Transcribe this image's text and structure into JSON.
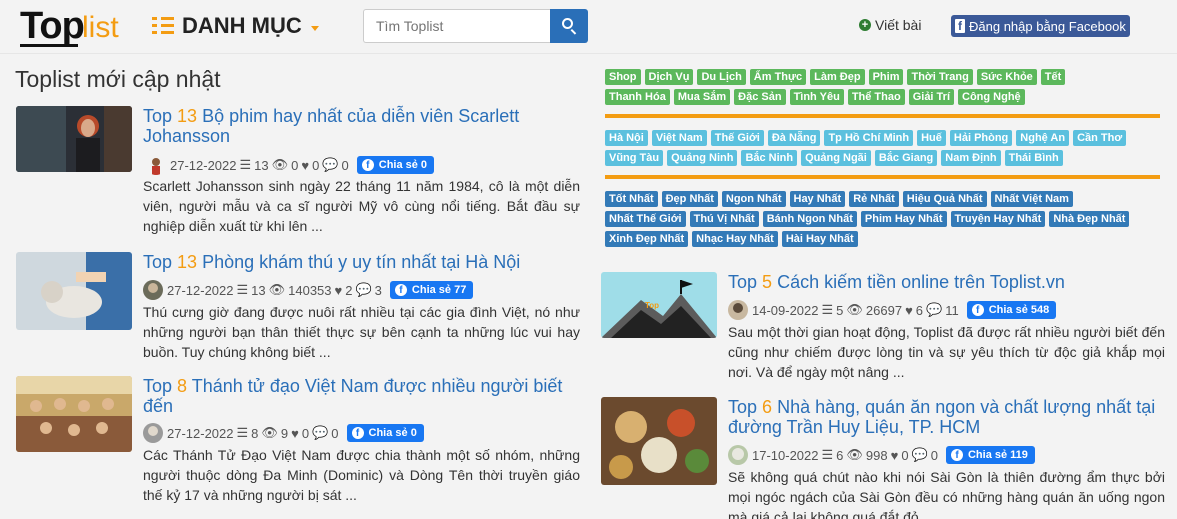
{
  "header": {
    "logo_text_1": "Top",
    "logo_text_2": "list",
    "menu_label": "DANH MỤC",
    "search_placeholder": "Tìm Toplist",
    "write_label": "Viết bài",
    "facebook_login_label": "Đăng nhập bằng Facebook"
  },
  "main": {
    "heading": "Toplist mới cập nhật"
  },
  "articles_left": [
    {
      "number": "13",
      "title_prefix": "Top",
      "title_rest": "Bộ phim hay nhất của diễn viên Scarlett Johansson",
      "date": "27-12-2022",
      "items": "13",
      "views": "0",
      "likes": "0",
      "comments": "0",
      "share_label": "Chia sẻ 0",
      "description": "Scarlett Johansson sinh ngày 22 tháng 11 năm 1984, cô là một diễn viên, người mẫu và ca sĩ người Mỹ vô cùng nổi tiếng. Bắt đầu sự nghiệp diễn xuất từ khi lên ..."
    },
    {
      "number": "13",
      "title_prefix": "Top",
      "title_rest": "Phòng khám thú y uy tín nhất tại Hà Nội",
      "date": "27-12-2022",
      "items": "13",
      "views": "140353",
      "likes": "2",
      "comments": "3",
      "share_label": "Chia sẻ 77",
      "description": "Thú cưng giờ đang được nuôi rất nhiều tại các gia đình Việt, nó như những người bạn thân thiết thực sự bên cạnh ta những lúc vui hay buồn. Tuy chúng không biết ..."
    },
    {
      "number": "8",
      "title_prefix": "Top",
      "title_rest": "Thánh tử đạo Việt Nam được nhiều người biết đến",
      "date": "27-12-2022",
      "items": "8",
      "views": "9",
      "likes": "0",
      "comments": "0",
      "share_label": "Chia sẻ 0",
      "description": "Các Thánh Tử Đạo Việt Nam được chia thành một số nhóm, những người thuộc dòng Đa Minh (Dominic) và Dòng Tên thời truyền giáo thế kỷ 17 và những người bị sát ..."
    }
  ],
  "articles_right": [
    {
      "number": "5",
      "title_prefix": "Top",
      "title_rest": "Cách kiếm tiền online trên Toplist.vn",
      "date": "14-09-2022",
      "items": "5",
      "views": "26697",
      "likes": "6",
      "comments": "11",
      "share_label": "Chia sẻ 548",
      "description": "Sau một thời gian hoạt động, Toplist đã được rất nhiều người biết đến cũng như chiếm được lòng tin và sự yêu thích từ độc giả khắp mọi nơi. Và để ngày một nâng ..."
    },
    {
      "number": "6",
      "title_prefix": "Top",
      "title_rest": "Nhà hàng, quán ăn ngon và chất lượng nhất tại đường Trần Huy Liệu, TP. HCM",
      "date": "17-10-2022",
      "items": "6",
      "views": "998",
      "likes": "0",
      "comments": "0",
      "share_label": "Chia sẻ 119",
      "description": "Sẽ không quá chút nào khi nói Sài Gòn là thiên đường ẩm thực bởi mọi ngóc ngách của Sài Gòn đều có những hàng quán ăn uống ngon mà giá cả lại không quá đắt đỏ ..."
    }
  ],
  "tags_categories": [
    "Shop",
    "Dịch Vụ",
    "Du Lịch",
    "Ẩm Thực",
    "Làm Đẹp",
    "Phim",
    "Thời Trang",
    "Sức Khỏe",
    "Tết",
    "Thanh Hóa",
    "Mua Sắm",
    "Đặc Sản",
    "Tình Yêu",
    "Thể Thao",
    "Giải Trí",
    "Công Nghệ"
  ],
  "tags_places": [
    "Hà Nội",
    "Việt Nam",
    "Thế Giới",
    "Đà Nẵng",
    "Tp Hồ Chí Minh",
    "Huế",
    "Hải Phòng",
    "Nghệ An",
    "Cần Thơ",
    "Vũng Tàu",
    "Quảng Ninh",
    "Bắc Ninh",
    "Quảng Ngãi",
    "Bắc Giang",
    "Nam Định",
    "Thái Bình"
  ],
  "tags_best": [
    "Tốt Nhất",
    "Đẹp Nhất",
    "Ngon Nhất",
    "Hay Nhất",
    "Rẻ Nhất",
    "Hiệu Quả Nhất",
    "Nhất Việt Nam",
    "Nhất Thế Giới",
    "Thú Vị Nhất",
    "Bánh Ngon Nhất",
    "Phim Hay Nhất",
    "Truyện Hay Nhất",
    "Nhà Đẹp Nhất",
    "Xinh Đẹp Nhất",
    "Nhạc Hay Nhất",
    "Hài Hay Nhất"
  ],
  "colors": {
    "accent": "#f39c12",
    "link": "#2a6fb8",
    "tag_green": "#5cb85c",
    "tag_blue": "#5bc0de",
    "tag_navy": "#337ab7",
    "facebook": "#1877f2"
  }
}
